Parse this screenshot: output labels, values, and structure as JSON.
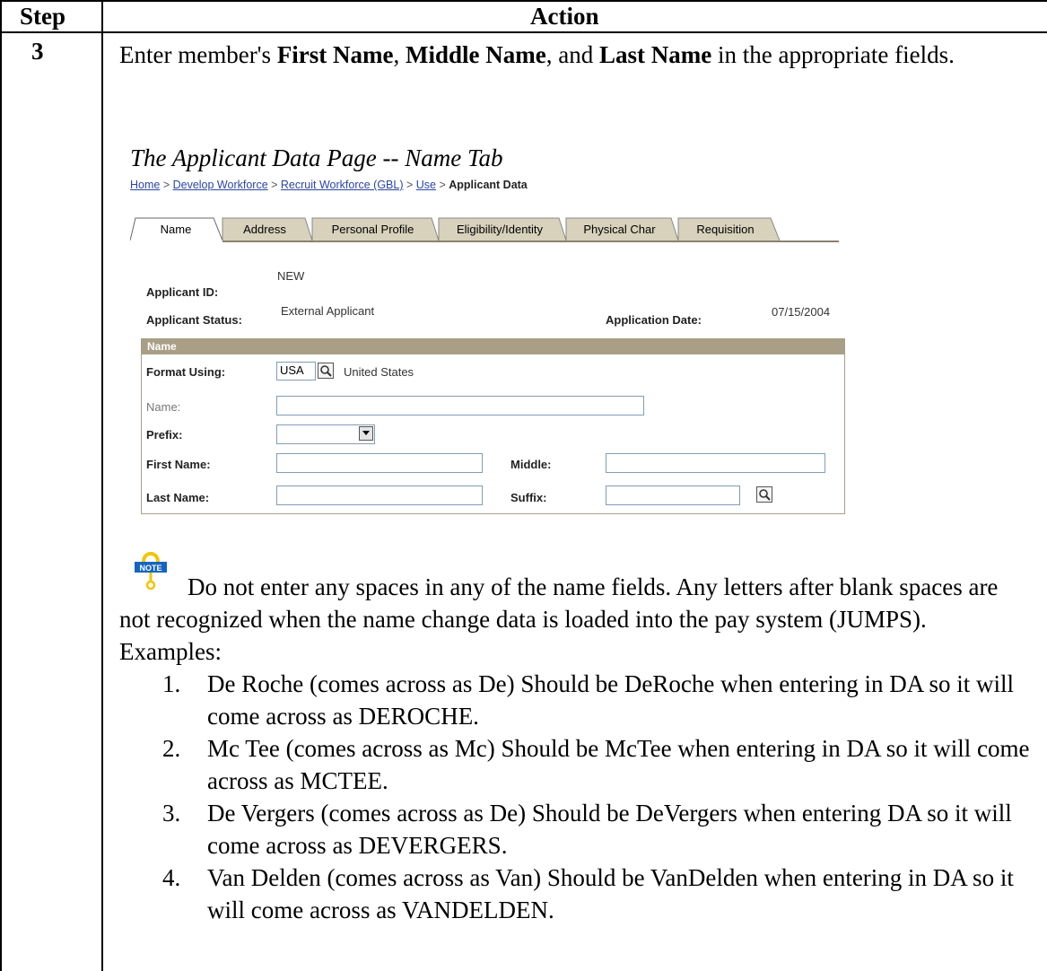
{
  "table": {
    "col_step": "Step",
    "col_action": "Action",
    "step_number": "3"
  },
  "instruction": {
    "pre": "Enter member's ",
    "first": "First Name",
    "sep1": ", ",
    "middle": "Middle Name",
    "sep2": ", and ",
    "last": "Last Name",
    "post": " in the appropriate fields."
  },
  "screenshot": {
    "caption": "The Applicant Data Page -- Name Tab",
    "breadcrumb": {
      "items": [
        "Home",
        "Develop Workforce",
        "Recruit Workforce (GBL)",
        "Use"
      ],
      "separator": " > ",
      "current": "Applicant Data"
    },
    "tabs": [
      "Name",
      "Address",
      "Personal Profile",
      "Eligibility/Identity",
      "Physical Char",
      "Requisition"
    ],
    "applicant_id_label": "Applicant ID:",
    "applicant_id_value": "NEW",
    "applicant_status_label": "Applicant Status:",
    "applicant_status_value": "External Applicant",
    "application_date_label": "Application Date:",
    "application_date_value": "07/15/2004",
    "group_title": "Name",
    "format_using_label": "Format Using:",
    "format_using_value": "USA",
    "format_country": "United States",
    "name_label": "Name:",
    "prefix_label": "Prefix:",
    "first_name_label": "First Name:",
    "middle_label": "Middle:",
    "last_name_label": "Last Name:",
    "suffix_label": "Suffix:"
  },
  "note": {
    "icon_label": "NOTE",
    "text": "Do not enter any spaces in any of the name fields. Any letters after blank spaces are not recognized when the name change data is loaded into the pay system (JUMPS). Examples:",
    "examples": [
      {
        "num": "1.",
        "text": "De Roche  (comes across as De)  Should be DeRoche when entering in DA so it will come across as DEROCHE."
      },
      {
        "num": "2.",
        "text": "Mc Tee (comes across as Mc) Should be McTee when entering in DA so it will come across as MCTEE."
      },
      {
        "num": "3.",
        "text": "De Vergers (comes across as De)  Should be DeVergers when entering DA so it will come across as DEVERGERS."
      },
      {
        "num": "4.",
        "text": "Van Delden (comes across as Van)  Should be VanDelden when entering in DA so it will come across as VANDELDEN."
      }
    ]
  },
  "colors": {
    "group_header": "#a89f86",
    "tab_inactive": "#d8d1bc",
    "link": "#2b45a6"
  }
}
